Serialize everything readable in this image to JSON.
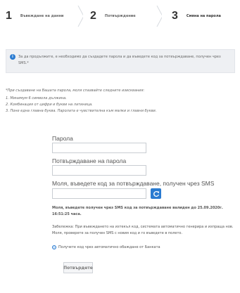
{
  "steps": [
    {
      "number": "1",
      "label": "Въвеждане на данни"
    },
    {
      "number": "2",
      "label": "Потвърждение"
    },
    {
      "number": "3",
      "label": "Смяна на парола"
    }
  ],
  "info": {
    "icon": "info-icon",
    "text": "За да продължите, е необходимо да създадете парола и да въведете код за потвърждаване, получен чрез SMS.*"
  },
  "requirements": {
    "intro": "*При създаване на Вашата парола, моля спазвайте следните изисквания:",
    "items": [
      "1. Минимум 6 символа дължина.",
      "2. Комбинация от цифри и букви на латиница.",
      "3. Поне една главна буква. Паролата е чувствителна към малки и главни букви."
    ]
  },
  "form": {
    "password_label": "Парола",
    "password_value": "",
    "confirm_label": "Потвърждаване на парола",
    "confirm_value": "",
    "sms_label": "Моля, въведете код за потвърждаване, получен чрез SMS",
    "sms_value": "",
    "refresh_icon": "refresh-icon",
    "sms_note": "Моля, въведете получен чрез SMS код за потвърждаване валиден до 25.09.2020г. 16:51:25 часа.",
    "remark": "Забележка: При въвеждането на изтекъл код, системата автоматично генерира и изпраща нов. Моля, проверете за получен SMS с новия код и го въведете в полето.",
    "voice_option": "Получете код чрез автоматично обаждане от Банката",
    "submit_label": "Потвърдете"
  },
  "colors": {
    "accent": "#2a7bd1",
    "info_bg": "#eef0f3"
  }
}
